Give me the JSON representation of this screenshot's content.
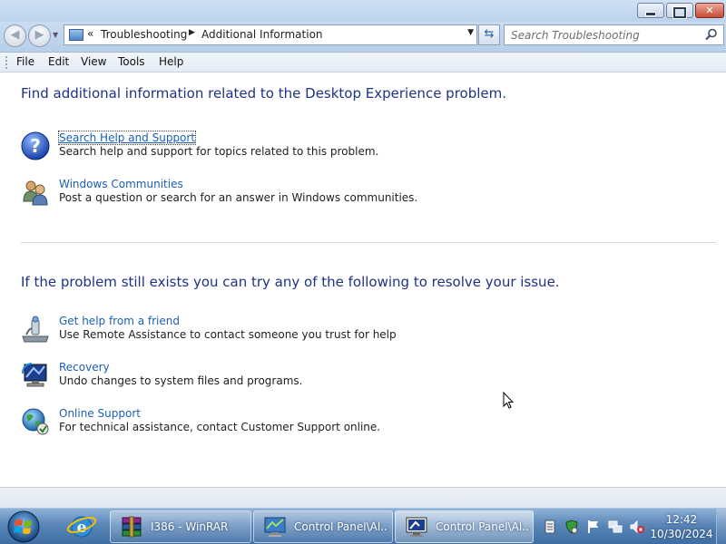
{
  "window": {
    "caption_buttons": {
      "minimize_icon": "minimize-icon",
      "maximize_icon": "maximize-icon",
      "close_icon": "close-icon"
    }
  },
  "navigation": {
    "back_icon": "back-arrow-icon",
    "forward_icon": "forward-arrow-icon",
    "address": {
      "overflow": "«",
      "crumbs": [
        "Troubleshooting",
        "Additional Information"
      ],
      "separator": "▶",
      "dropdown": "▼"
    },
    "refresh_icon": "refresh-icon",
    "search": {
      "placeholder": "Search Troubleshooting",
      "value": ""
    }
  },
  "menubar": {
    "items": [
      "File",
      "Edit",
      "View",
      "Tools",
      "Help"
    ]
  },
  "content": {
    "section1": {
      "heading": "Find additional information related to the Desktop Experience problem.",
      "tasks": [
        {
          "icon": "help-icon",
          "link": "Search Help and Support",
          "description": "Search help and support for topics related to this problem."
        },
        {
          "icon": "communities-icon",
          "link": "Windows Communities",
          "description": "Post a question or search for an answer in Windows communities."
        }
      ]
    },
    "section2": {
      "heading": "If the problem still exists you can try any of the following to resolve your issue.",
      "tasks": [
        {
          "icon": "remote-assistance-icon",
          "link": "Get help from a friend",
          "description": "Use Remote Assistance to contact someone you trust for help"
        },
        {
          "icon": "recovery-icon",
          "link": "Recovery",
          "description": "Undo changes to system files and programs."
        },
        {
          "icon": "online-support-icon",
          "link": "Online Support",
          "description": "For technical assistance, contact Customer Support online."
        }
      ]
    }
  },
  "taskbar": {
    "start_icon": "windows-start-icon",
    "pinned": [
      {
        "icon": "internet-explorer-icon"
      }
    ],
    "tasks": [
      {
        "icon": "winrar-icon",
        "label": "I386 - WinRAR"
      },
      {
        "icon": "control-panel-icon",
        "label": "Control Panel\\Al..."
      },
      {
        "icon": "control-panel-icon",
        "label": "Control Panel\\Al...",
        "active": true
      }
    ],
    "tray": {
      "icons": [
        "notes-icon",
        "security-icon",
        "action-center-flag-icon",
        "network-icon",
        "volume-muted-icon"
      ],
      "time": "12:42",
      "date": "10/30/2024"
    }
  }
}
